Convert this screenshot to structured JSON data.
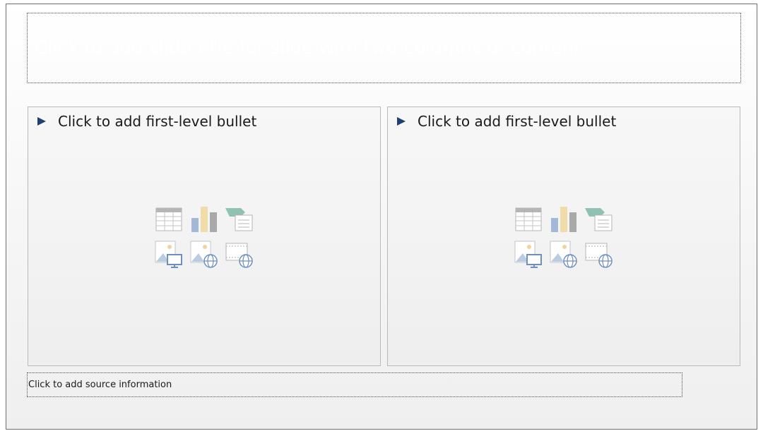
{
  "slide": {
    "title_placeholder": "Click to add slide title for slide with two-columns of content",
    "left_column": {
      "bullet": "Click to add first-level bullet",
      "insert_icons": [
        "insert-table-icon",
        "insert-chart-icon",
        "insert-smartart-icon",
        "insert-picture-icon",
        "insert-online-picture-icon",
        "insert-video-icon"
      ]
    },
    "right_column": {
      "bullet": "Click to add first-level bullet",
      "insert_icons": [
        "insert-table-icon",
        "insert-chart-icon",
        "insert-smartart-icon",
        "insert-picture-icon",
        "insert-online-picture-icon",
        "insert-video-icon"
      ]
    },
    "source_placeholder": "Click to add source information"
  },
  "colors": {
    "bullet_arrow": "#1f3f73",
    "title_text": "#ffffff",
    "border_dotted": "#4a4a4a"
  }
}
